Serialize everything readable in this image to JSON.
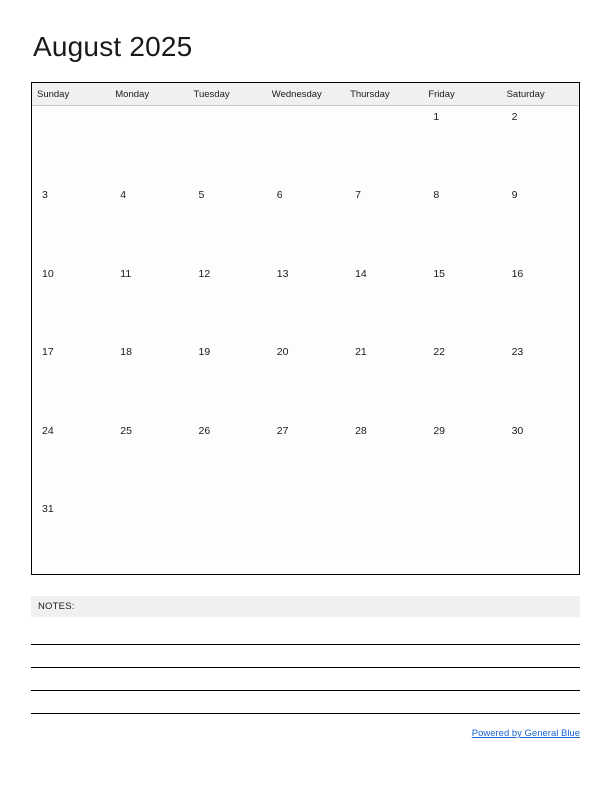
{
  "document": {
    "title": "August 2025",
    "month": "August",
    "year": "2025"
  },
  "calendar": {
    "weekday_headers": [
      "Sunday",
      "Monday",
      "Tuesday",
      "Wednesday",
      "Thursday",
      "Friday",
      "Saturday"
    ],
    "weeks": [
      [
        "",
        "",
        "",
        "",
        "",
        "1",
        "2"
      ],
      [
        "3",
        "4",
        "5",
        "6",
        "7",
        "8",
        "9"
      ],
      [
        "10",
        "11",
        "12",
        "13",
        "14",
        "15",
        "16"
      ],
      [
        "17",
        "18",
        "19",
        "20",
        "21",
        "22",
        "23"
      ],
      [
        "24",
        "25",
        "26",
        "27",
        "28",
        "29",
        "30"
      ],
      [
        "31",
        "",
        "",
        "",
        "",
        "",
        ""
      ]
    ]
  },
  "notes": {
    "label": "NOTES:",
    "line_count": 4
  },
  "footer": {
    "link_text": "Powered by General Blue"
  },
  "colors": {
    "header_background": "#f0f0f0",
    "border": "#000000",
    "text": "#1a1a1a",
    "link": "#1b64d4",
    "page_background": "#ffffff"
  }
}
